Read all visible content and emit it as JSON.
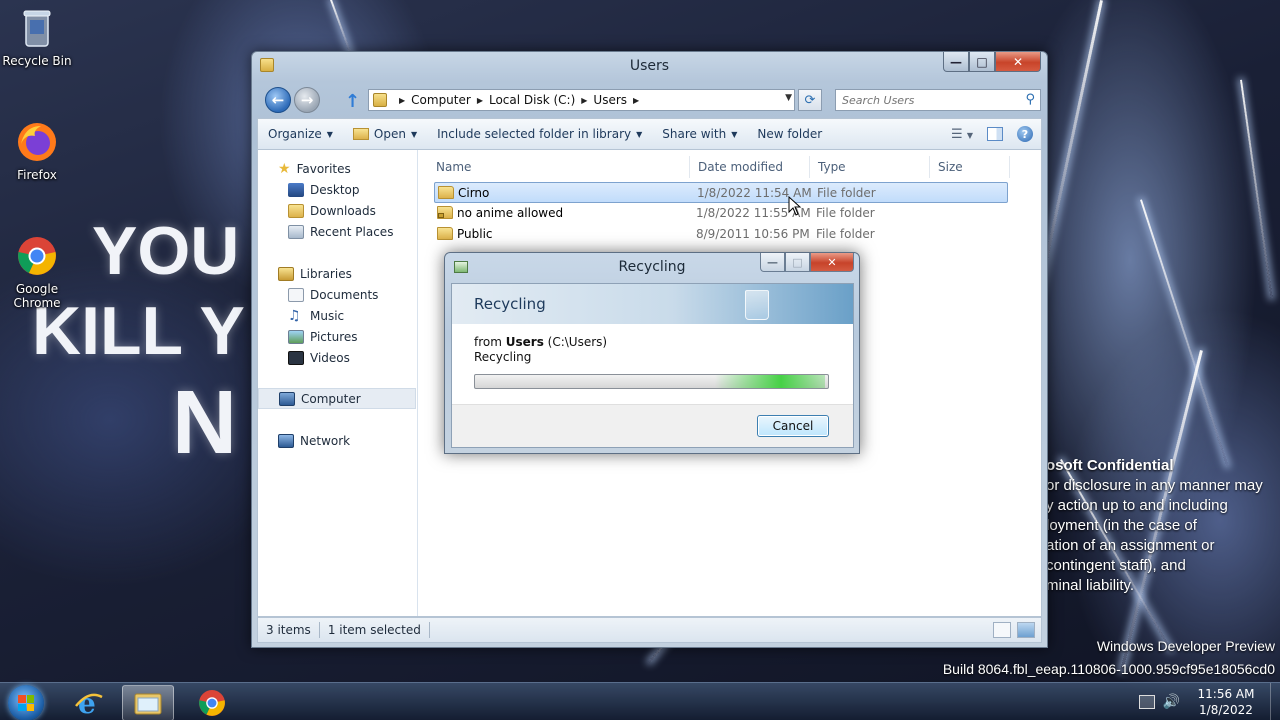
{
  "desktop": {
    "icons": [
      {
        "label": "Recycle Bin"
      },
      {
        "label": "Firefox"
      },
      {
        "label": "Google Chrome"
      }
    ],
    "wallpaper_text": [
      "YOU",
      "KILL Y",
      "N"
    ],
    "watermark_confidential": [
      "osoft Confidential",
      "or disclosure in any manner may",
      "y action up to and including",
      "loyment (in the case of",
      "ation of an assignment or",
      "contingent staff), and",
      "minal liability."
    ],
    "build_line1": "Windows Developer Preview",
    "build_line2": "Build 8064.fbl_eeap.110806-1000.959cf95e18056cd0"
  },
  "explorer": {
    "title": "Users",
    "breadcrumb": [
      "Computer",
      "Local Disk (C:)",
      "Users"
    ],
    "search_placeholder": "Search Users",
    "toolbar": {
      "organize": "Organize",
      "open": "Open",
      "include": "Include selected folder in library",
      "share": "Share with",
      "new_folder": "New folder"
    },
    "nav": {
      "favorites": "Favorites",
      "desktop": "Desktop",
      "downloads": "Downloads",
      "recent": "Recent Places",
      "libraries": "Libraries",
      "documents": "Documents",
      "music": "Music",
      "pictures": "Pictures",
      "videos": "Videos",
      "computer": "Computer",
      "network": "Network"
    },
    "columns": {
      "name": "Name",
      "date": "Date modified",
      "type": "Type",
      "size": "Size"
    },
    "rows": [
      {
        "name": "Cirno",
        "date": "1/8/2022 11:54 AM",
        "type": "File folder"
      },
      {
        "name": "no anime allowed",
        "date": "1/8/2022 11:55 AM",
        "type": "File folder"
      },
      {
        "name": "Public",
        "date": "8/9/2011 10:56 PM",
        "type": "File folder"
      }
    ],
    "status": {
      "count": "3 items",
      "selected": "1 item selected"
    }
  },
  "dialog": {
    "title": "Recycling",
    "header": "Recycling",
    "from_prefix": "from ",
    "from_name": "Users",
    "from_path": " (C:\\Users)",
    "action": "Recycling",
    "cancel": "Cancel",
    "progress_state": "indeterminate"
  },
  "taskbar": {
    "time": "11:56 AM",
    "date": "1/8/2022"
  },
  "colors": {
    "selection": "#c1dcfb",
    "close_red": "#c8442a",
    "progress_green": "#46d146"
  }
}
